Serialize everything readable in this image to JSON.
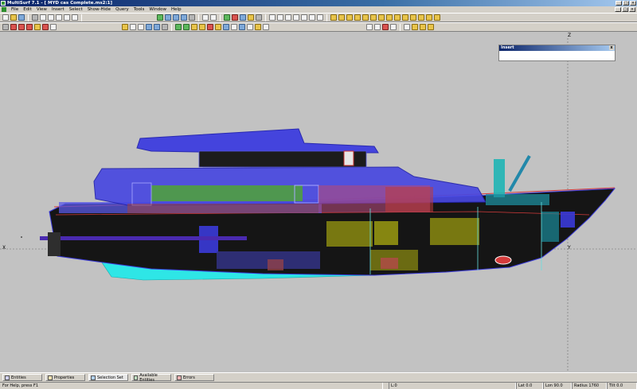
{
  "window": {
    "title": "MultiSurf 7.1 - [ MYD cas Complete.ms2:1]",
    "minimize": "_",
    "maximize": "□",
    "close": "×"
  },
  "menu": [
    "File",
    "Edit",
    "View",
    "Insert",
    "Select",
    "Show-Hide",
    "Query",
    "Tools",
    "Window",
    "Help"
  ],
  "viewport": {
    "axis_z": "Z",
    "axis_x": "X",
    "axis_y": "Y",
    "background": "#c2c2c2"
  },
  "insert_panel": {
    "title": "Insert",
    "close": "x"
  },
  "taskbar": {
    "tabs": [
      "Entities",
      "Properties",
      "Selection Set",
      "Available Entities",
      "Errors"
    ]
  },
  "status": {
    "help": "For Help, press F1",
    "l": "L:0",
    "lat": "Lat 0.0",
    "lon": "Lon 90.0",
    "radius": "Radius 1760",
    "tilt": "Tilt 0.0"
  },
  "colors": {
    "title_gradient_start": "#0a246a",
    "title_gradient_end": "#a6caf0",
    "hull_black": "#1a1a1a",
    "deck_blue": "#5a5ae6",
    "bottom_cyan": "#2ee6e6"
  }
}
